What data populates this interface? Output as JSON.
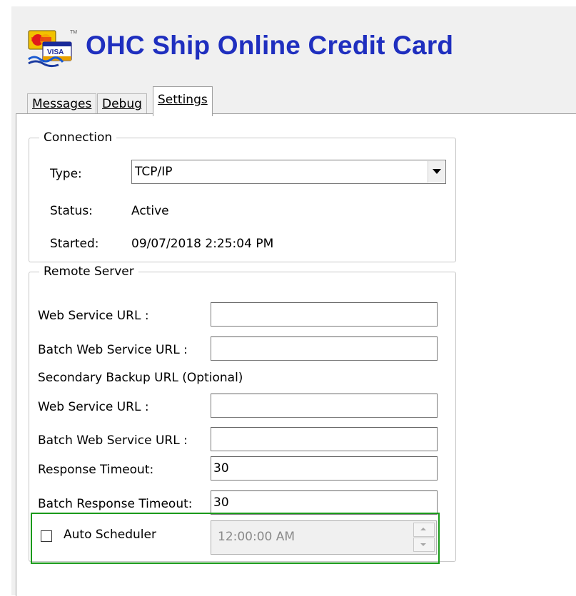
{
  "app": {
    "title": "OHC Ship Online Credit Card",
    "logo_icon": "credit-card-visa-logo"
  },
  "tabs": [
    {
      "label": "Messages",
      "active": false
    },
    {
      "label": "Debug",
      "active": false
    },
    {
      "label": "Settings",
      "active": true
    }
  ],
  "connection": {
    "legend": "Connection",
    "type_label": "Type:",
    "type_value": "TCP/IP",
    "status_label": "Status:",
    "status_value": "Active",
    "started_label": "Started:",
    "started_value": "09/07/2018 2:25:04 PM"
  },
  "remote_server": {
    "legend": "Remote Server",
    "web_service_url_label": "Web Service URL :",
    "web_service_url_value": "",
    "batch_web_service_url_label": "Batch Web Service URL :",
    "batch_web_service_url_value": "",
    "secondary_heading": "Secondary Backup URL (Optional)",
    "secondary_web_service_url_label": "Web Service URL :",
    "secondary_web_service_url_value": "",
    "secondary_batch_web_service_url_label": "Batch Web Service URL :",
    "secondary_batch_web_service_url_value": "",
    "response_timeout_label": "Response Timeout:",
    "response_timeout_value": "30",
    "batch_response_timeout_label": "Batch Response Timeout:",
    "batch_response_timeout_value": "30"
  },
  "scheduler": {
    "label": "Auto Scheduler",
    "checked": false,
    "time_value": "12:00:00 AM",
    "highlight_color": "#1a9a1a"
  },
  "colors": {
    "title": "#1f2fbf",
    "panel_bg": "#ffffff",
    "window_bg": "#f0f0f0"
  }
}
